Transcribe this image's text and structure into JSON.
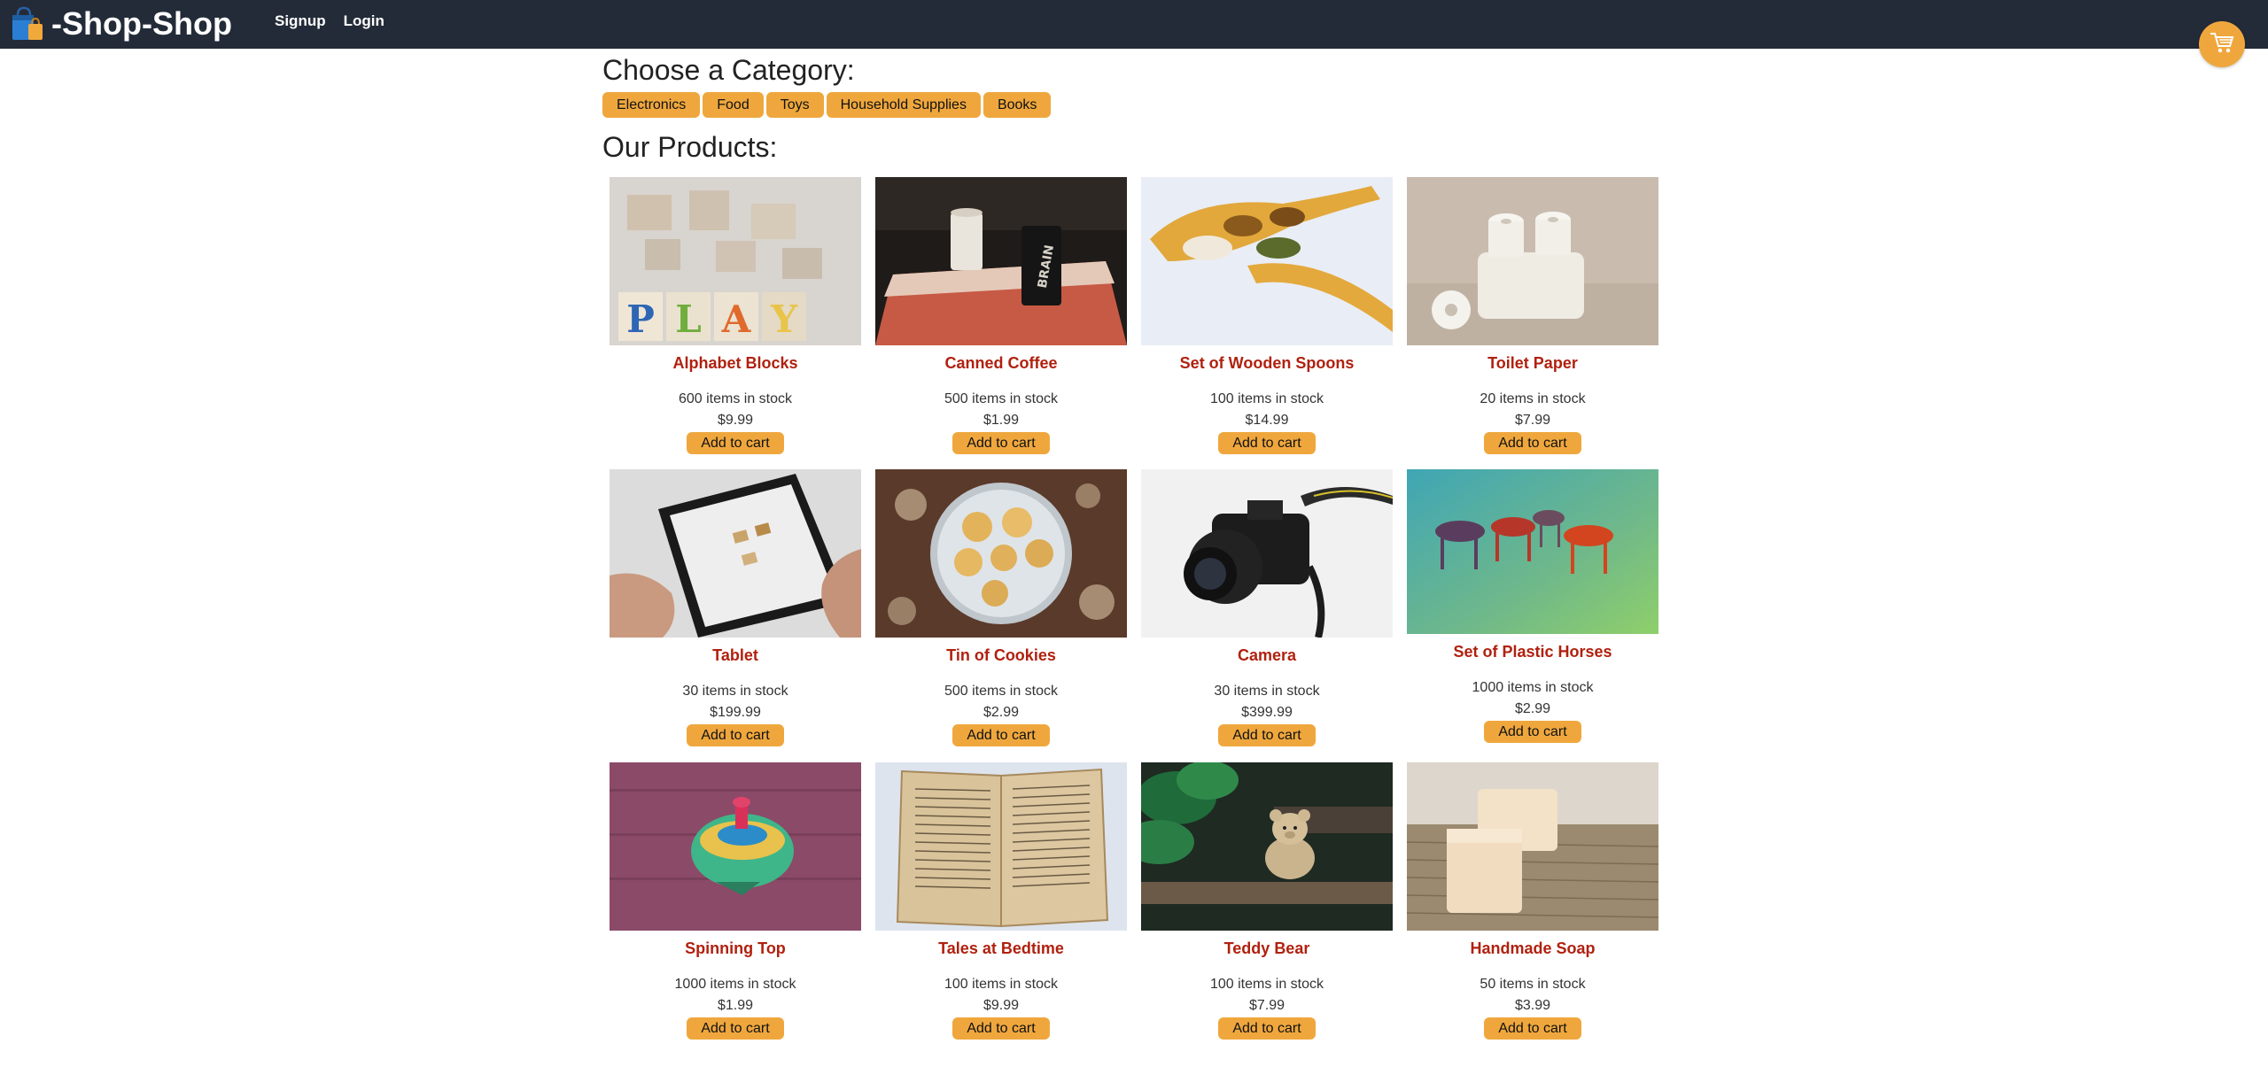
{
  "header": {
    "brand": "-Shop-Shop",
    "nav": [
      "Signup",
      "Login"
    ]
  },
  "categories": {
    "title": "Choose a Category:",
    "items": [
      "Electronics",
      "Food",
      "Toys",
      "Household Supplies",
      "Books"
    ]
  },
  "products": {
    "title": "Our Products:",
    "add_label": "Add to cart",
    "items": [
      {
        "name": "Alphabet Blocks",
        "stock": "600 items in stock",
        "price": "$9.99"
      },
      {
        "name": "Canned Coffee",
        "stock": "500 items in stock",
        "price": "$1.99"
      },
      {
        "name": "Set of Wooden Spoons",
        "stock": "100 items in stock",
        "price": "$14.99"
      },
      {
        "name": "Toilet Paper",
        "stock": "20 items in stock",
        "price": "$7.99"
      },
      {
        "name": "Tablet",
        "stock": "30 items in stock",
        "price": "$199.99"
      },
      {
        "name": "Tin of Cookies",
        "stock": "500 items in stock",
        "price": "$2.99"
      },
      {
        "name": "Camera",
        "stock": "30 items in stock",
        "price": "$399.99"
      },
      {
        "name": "Set of Plastic Horses",
        "stock": "1000 items in stock",
        "price": "$2.99"
      },
      {
        "name": "Spinning Top",
        "stock": "1000 items in stock",
        "price": "$1.99"
      },
      {
        "name": "Tales at Bedtime",
        "stock": "100 items in stock",
        "price": "$9.99"
      },
      {
        "name": "Teddy Bear",
        "stock": "100 items in stock",
        "price": "$7.99"
      },
      {
        "name": "Handmade Soap",
        "stock": "50 items in stock",
        "price": "$3.99"
      }
    ]
  },
  "colors": {
    "header_bg": "#232b38",
    "accent": "#efa73d",
    "product_name": "#b0210f"
  },
  "icons": [
    "shopping-bag-icon",
    "cart-icon"
  ]
}
